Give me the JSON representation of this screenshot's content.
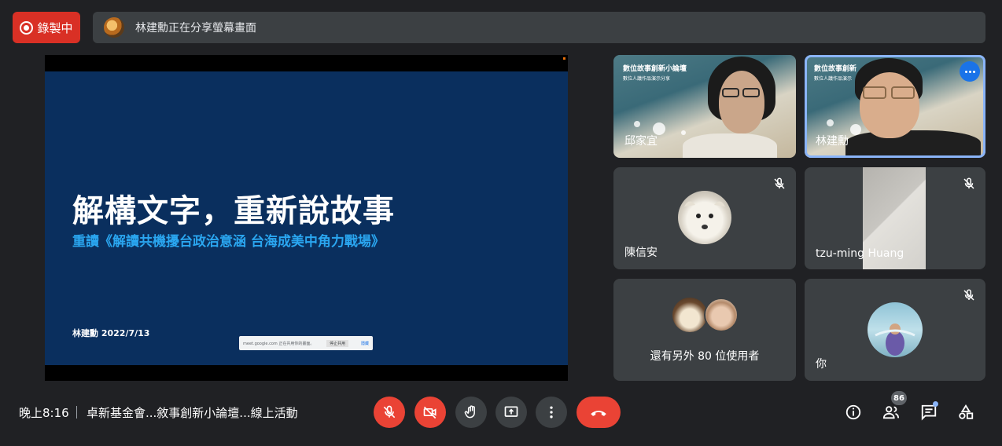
{
  "top_bar": {
    "recording_label": "錄製中",
    "presenter_notice": "林建勳正在分享螢幕畫面"
  },
  "presentation": {
    "title": "解構文字，重新說故事",
    "subtitle": "重讀《解讀共機擾台政治意涵 台海成美中角力戰場》",
    "author_date": "林建勳 2022/7/13",
    "share_notice_text": "meet.google.com 正在共用你的畫面。",
    "share_notice_stop": "停止共用",
    "share_notice_hide": "隱藏"
  },
  "participants": [
    {
      "name": "邱家宜",
      "video_title": "數位故事創新小論壇",
      "video_sub": "數位人議作品演示分享"
    },
    {
      "name": "林建勳",
      "video_title": "數位故事創新",
      "video_sub": "數位人議作品演示"
    },
    {
      "name": "陳信安"
    },
    {
      "name": "tzu-ming Huang"
    },
    {
      "name": "還有另外 80 位使用者"
    },
    {
      "name": "你"
    }
  ],
  "bottom_bar": {
    "time": "晚上8:16",
    "meeting_title": "卓新基金會...敘事創新小論壇...線上活動",
    "people_count": "86"
  },
  "colors": {
    "background": "#202124",
    "tile": "#3c4043",
    "danger": "#ea4335",
    "accent": "#8ab4f8",
    "slide_bg": "#0a2f5e",
    "slide_subtitle": "#2aa6f0"
  }
}
